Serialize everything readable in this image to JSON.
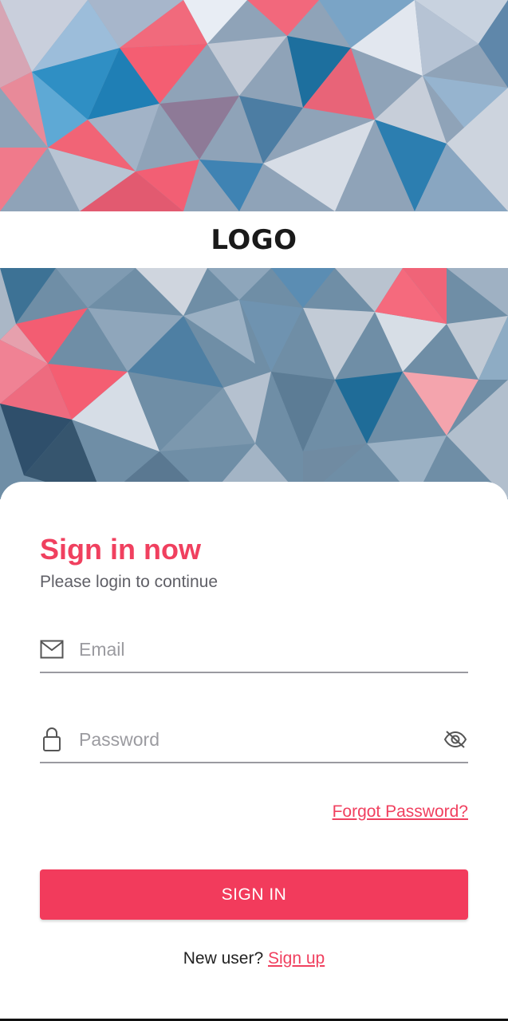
{
  "header": {
    "logo_text": "LOGO"
  },
  "signin": {
    "title": "Sign in now",
    "subtitle": "Please login to continue",
    "email_placeholder": "Email",
    "password_placeholder": "Password",
    "forgot_label": "Forgot Password?",
    "submit_label": "SIGN IN",
    "new_user_text": "New user?",
    "signup_label": "Sign up"
  },
  "colors": {
    "accent": "#f23b5c",
    "title": "#f0405f",
    "subtitle": "#5f5f66",
    "placeholder": "#9b9ba0",
    "underline": "#9a9aa0"
  },
  "icons": {
    "email": "envelope-icon",
    "password": "lock-icon",
    "visibility": "eye-off-icon"
  }
}
